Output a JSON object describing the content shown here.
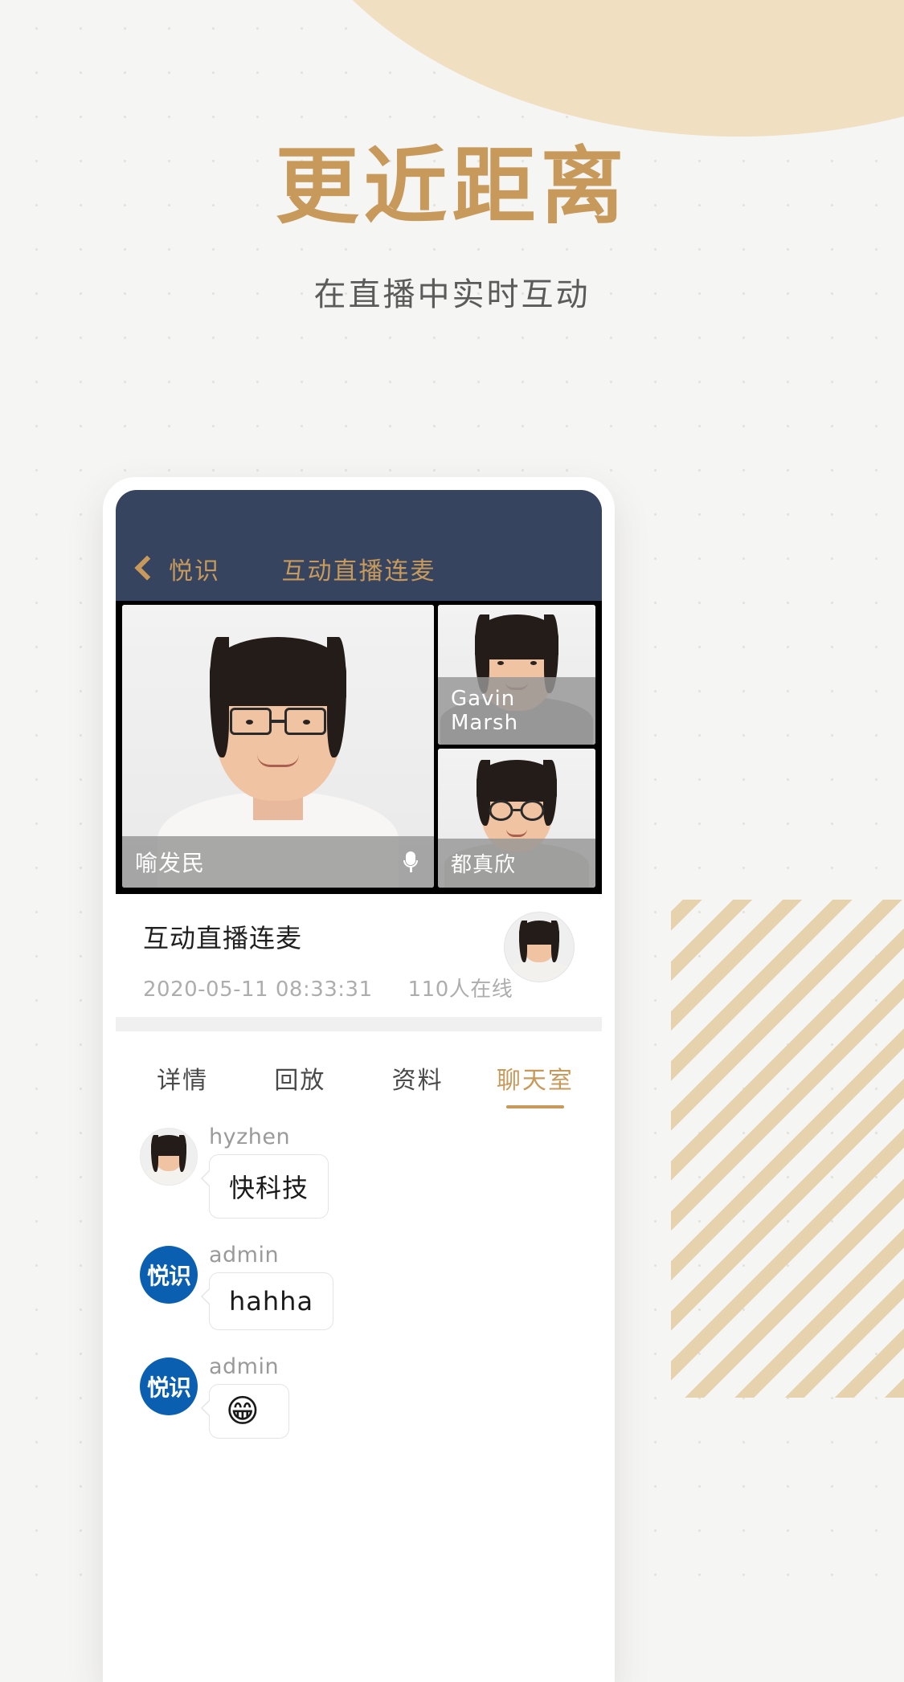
{
  "hero": {
    "headline": "更近距离",
    "subhead": "在直播中实时互动",
    "headline_color": "#c79a5b",
    "subhead_color": "#5b5b5b"
  },
  "phone": {
    "navbar": {
      "back_label": "悦识",
      "title": "互动直播连麦",
      "background_color": "#36445f",
      "accent_color": "#c79a5b"
    },
    "video_grid": {
      "main": {
        "name": "喻发民",
        "mic_icon": "microphone-icon"
      },
      "side": [
        {
          "name": "Gavin Marsh"
        },
        {
          "name": "都真欣"
        }
      ]
    },
    "session": {
      "title": "互动直播连麦",
      "datetime": "2020-05-11 08:33:31",
      "viewers": "110人在线"
    },
    "tabs": [
      {
        "label": "详情",
        "active": false
      },
      {
        "label": "回放",
        "active": false
      },
      {
        "label": "资料",
        "active": false
      },
      {
        "label": "聊天室",
        "active": true
      }
    ],
    "chat": [
      {
        "name": "hyzhen",
        "message": "快科技",
        "avatar": "photo-avatar",
        "is_emoji": false
      },
      {
        "name": "admin",
        "message": "hahha",
        "avatar": "brand-avatar",
        "brand_text": "悦识",
        "is_emoji": false
      },
      {
        "name": "admin",
        "message": "😁",
        "avatar": "brand-avatar",
        "brand_text": "悦识",
        "is_emoji": true
      }
    ]
  }
}
